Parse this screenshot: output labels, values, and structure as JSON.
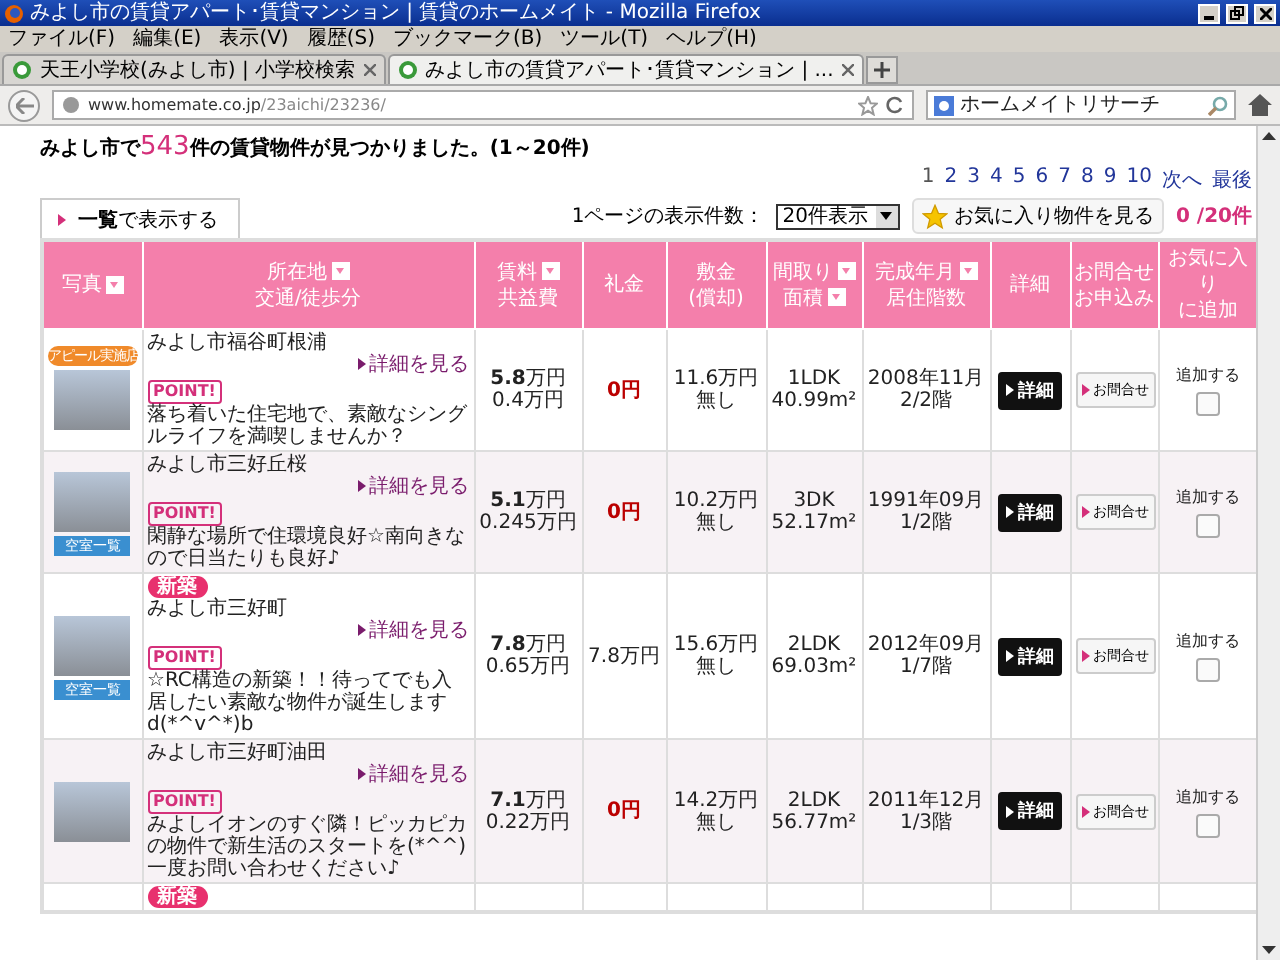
{
  "window": {
    "title": "みよし市の賃貸アパート･賃貸マンション | 賃貸のホームメイト - Mozilla Firefox"
  },
  "menu": [
    "ファイル(F)",
    "編集(E)",
    "表示(V)",
    "履歴(S)",
    "ブックマーク(B)",
    "ツール(T)",
    "ヘルプ(H)"
  ],
  "tabs": [
    {
      "label": "天王小学校(みよし市) | 小学校検索",
      "selected": false
    },
    {
      "label": "みよし市の賃貸アパート･賃貸マンション | ...",
      "selected": true
    }
  ],
  "address_bar": {
    "url_host": "www.homemate.co.jp",
    "url_path": "/23aichi/23236/"
  },
  "search": {
    "placeholder": "ホームメイトリサーチ"
  },
  "heading": {
    "before": "みよし市で",
    "count": "543",
    "after": "件の賃貸物件が見つかりました。(1～20件)"
  },
  "pager": [
    {
      "label": "1",
      "selected": true
    },
    {
      "label": "2",
      "selected": false
    },
    {
      "label": "3",
      "selected": false
    },
    {
      "label": "4",
      "selected": false
    },
    {
      "label": "5",
      "selected": false
    },
    {
      "label": "6",
      "selected": false
    },
    {
      "label": "7",
      "selected": false
    },
    {
      "label": "8",
      "selected": false
    },
    {
      "label": "9",
      "selected": false
    },
    {
      "label": "10",
      "selected": false
    },
    {
      "label": "次へ",
      "selected": false
    },
    {
      "label": "最後",
      "selected": false
    }
  ],
  "view_tab": {
    "label": "**一覧**で表示する"
  },
  "per_page": {
    "label": "1ページの表示件数：",
    "value": "20件表示"
  },
  "favorites": {
    "label": "お気に入り物件を見る",
    "count": "0",
    "total": "/20件"
  },
  "columns": [
    {
      "lines": [
        {
          "text": "写真",
          "sort": true
        }
      ]
    },
    {
      "lines": [
        {
          "text": "所在地",
          "sort": true
        },
        {
          "text": "交通/徒歩分",
          "sort": false
        }
      ]
    },
    {
      "lines": [
        {
          "text": "賃料",
          "sort": true
        },
        {
          "text": "共益費",
          "sort": false
        }
      ]
    },
    {
      "lines": [
        {
          "text": "礼金",
          "sort": false
        }
      ]
    },
    {
      "lines": [
        {
          "text": "敷金",
          "sort": false
        },
        {
          "text": "(償却)",
          "sort": false
        }
      ]
    },
    {
      "lines": [
        {
          "text": "間取り",
          "sort": true
        },
        {
          "text": "面積",
          "sort": true
        }
      ]
    },
    {
      "lines": [
        {
          "text": "完成年月",
          "sort": true
        },
        {
          "text": "居住階数",
          "sort": false
        }
      ]
    },
    {
      "lines": [
        {
          "text": "詳細",
          "sort": false
        }
      ]
    },
    {
      "lines": [
        {
          "text": "お問合せ",
          "sort": false
        },
        {
          "text": "お申込み",
          "sort": false
        }
      ]
    },
    {
      "lines": [
        {
          "text": "お気に入り",
          "sort": false
        },
        {
          "text": "に追加",
          "sort": false
        }
      ]
    }
  ],
  "rows": [
    {
      "shop_badge": "アピール実施店",
      "new_badge": null,
      "vacancy": null,
      "address": "みよし市福谷町根浦",
      "detail_link": "詳細を見る",
      "point": "POINT!",
      "comment": "落ち着いた住宅地で、素敵なシングルライフを満喫しませんか？",
      "rent": "5.8",
      "rent_unit": "万円",
      "fee": "0.4万円",
      "key_money": "0円",
      "deposit": "11.6万円",
      "amortization": "無し",
      "layout": "1LDK",
      "area": "40.99m²",
      "built": "2008年11月",
      "floor": "2/2階",
      "detail_button": "詳細",
      "inquiry_button": "お問合せ",
      "favorite_label": "追加する",
      "favorite_checked": false
    },
    {
      "shop_badge": null,
      "new_badge": null,
      "vacancy": "空室一覧",
      "address": "みよし市三好丘桜",
      "detail_link": "詳細を見る",
      "point": "POINT!",
      "comment": "閑静な場所で住環境良好☆南向きなので日当たりも良好♪",
      "rent": "5.1",
      "rent_unit": "万円",
      "fee": "0.245万円",
      "key_money": "0円",
      "deposit": "10.2万円",
      "amortization": "無し",
      "layout": "3DK",
      "area": "52.17m²",
      "built": "1991年09月",
      "floor": "1/2階",
      "detail_button": "詳細",
      "inquiry_button": "お問合せ",
      "favorite_label": "追加する",
      "favorite_checked": false
    },
    {
      "shop_badge": null,
      "new_badge": "新築",
      "vacancy": "空室一覧",
      "address": "みよし市三好町",
      "detail_link": "詳細を見る",
      "point": "POINT!",
      "comment": "☆RC構造の新築！！待ってでも入居したい素敵な物件が誕生しますd(*^v^*)b",
      "rent": "7.8",
      "rent_unit": "万円",
      "fee": "0.65万円",
      "key_money": "7.8万円",
      "deposit": "15.6万円",
      "amortization": "無し",
      "layout": "2LDK",
      "area": "69.03m²",
      "built": "2012年09月",
      "floor": "1/7階",
      "detail_button": "詳細",
      "inquiry_button": "お問合せ",
      "favorite_label": "追加する",
      "favorite_checked": false
    },
    {
      "shop_badge": null,
      "new_badge": null,
      "vacancy": null,
      "address": "みよし市三好町油田",
      "detail_link": "詳細を見る",
      "point": "POINT!",
      "comment": "みよしイオンのすぐ隣！ピッカピカの物件で新生活のスタートを(*^^)一度お問い合わせください♪",
      "rent": "7.1",
      "rent_unit": "万円",
      "fee": "0.22万円",
      "key_money": "0円",
      "deposit": "14.2万円",
      "amortization": "無し",
      "layout": "2LDK",
      "area": "56.77m²",
      "built": "2011年12月",
      "floor": "1/3階",
      "detail_button": "詳細",
      "inquiry_button": "お問合せ",
      "favorite_label": "追加する",
      "favorite_checked": false
    },
    {
      "shop_badge": null,
      "new_badge": "新築",
      "vacancy": null
    }
  ]
}
